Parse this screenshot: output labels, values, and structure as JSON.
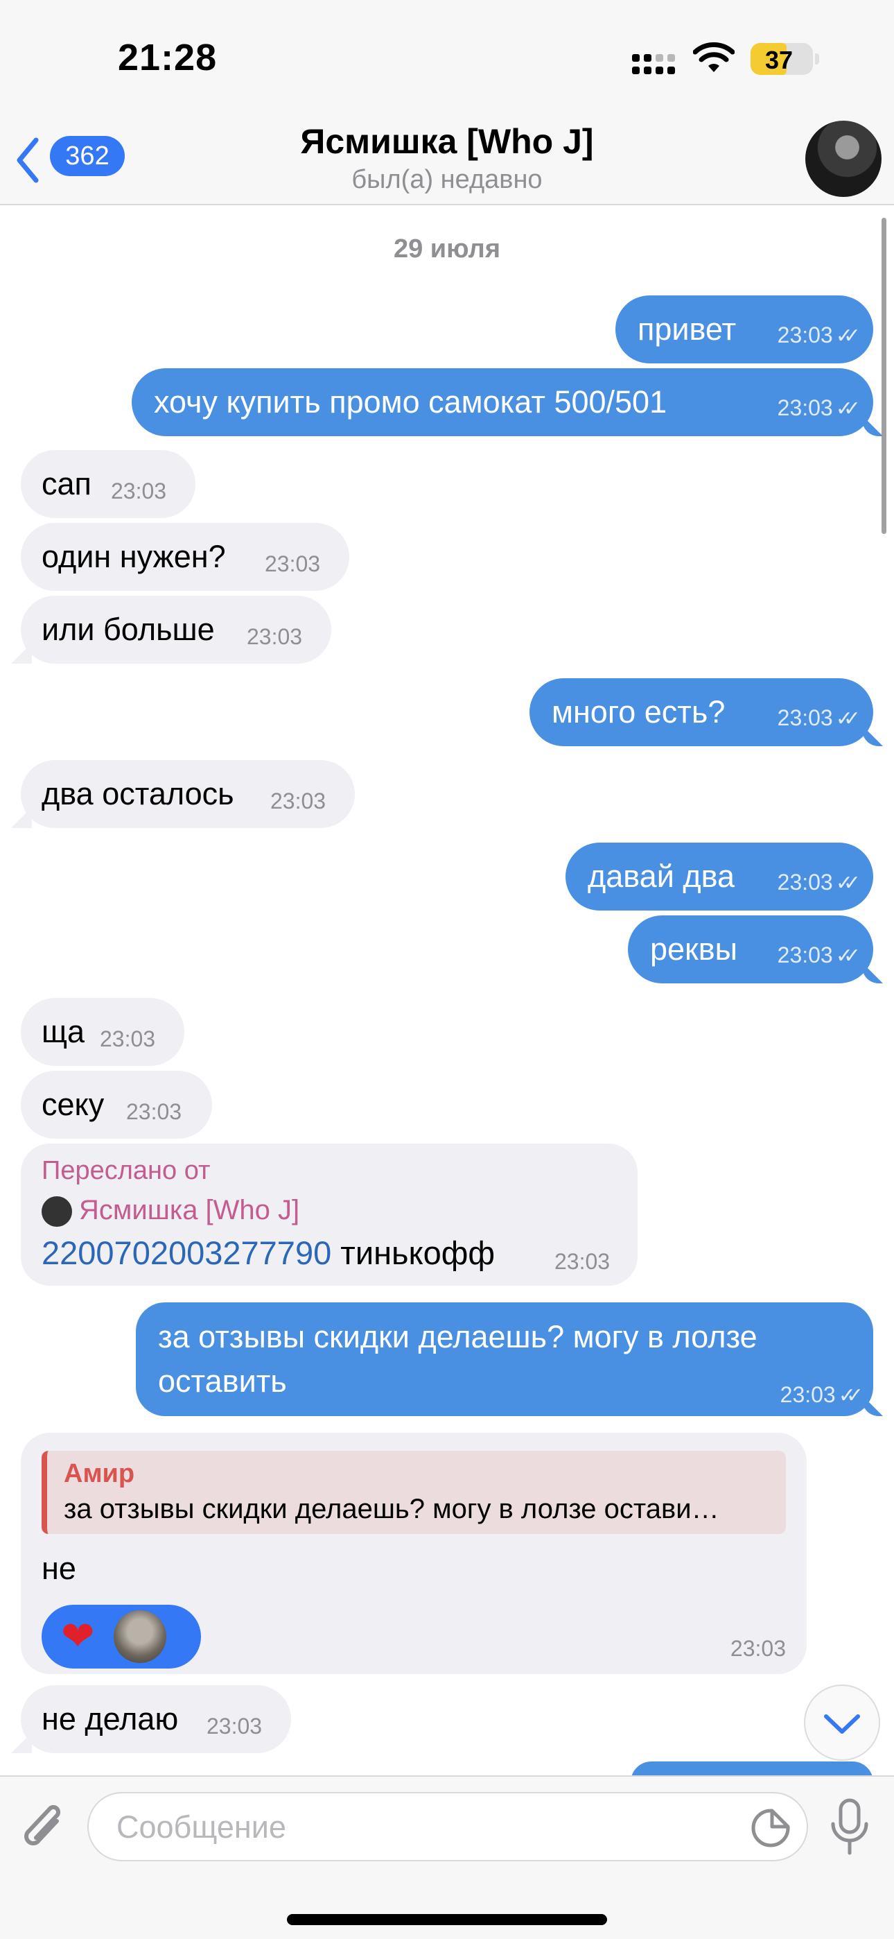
{
  "status": {
    "time": "21:28",
    "battery": "37"
  },
  "header": {
    "back_count": "362",
    "title": "Ясмишка [Who J]",
    "subtitle": "был(а) недавно"
  },
  "chat": {
    "date": "29 июля",
    "messages": [
      {
        "dir": "out",
        "text": "привет",
        "time": "23:03"
      },
      {
        "dir": "out",
        "text": "хочу купить промо самокат 500/501",
        "time": "23:03"
      },
      {
        "dir": "in",
        "text": "сап",
        "time": "23:03"
      },
      {
        "dir": "in",
        "text": "один нужен?",
        "time": "23:03"
      },
      {
        "dir": "in",
        "text": "или больше",
        "time": "23:03"
      },
      {
        "dir": "out",
        "text": "много есть?",
        "time": "23:03"
      },
      {
        "dir": "in",
        "text": "два осталось",
        "time": "23:03"
      },
      {
        "dir": "out",
        "text": "давай два",
        "time": "23:03"
      },
      {
        "dir": "out",
        "text": "реквы",
        "time": "23:03"
      },
      {
        "dir": "in",
        "text": "ща",
        "time": "23:03"
      },
      {
        "dir": "in",
        "text": "секу",
        "time": "23:03"
      }
    ],
    "forwarded": {
      "label": "Переслано от",
      "from": "Ясмишка [Who J]",
      "number": "2200702003277790",
      "bank": " тинькофф",
      "time": "23:03"
    },
    "long_out": {
      "text": "за отзывы скидки делаешь? могу в лолзе оставить",
      "time": "23:03"
    },
    "reply": {
      "quote_name": "Амир",
      "quote_text": "за отзывы скидки делаешь? могу в лолзе остави…",
      "text": "не",
      "reaction": "❤",
      "time": "23:03"
    },
    "last_in": {
      "text": "не делаю",
      "time": "23:03"
    }
  },
  "input": {
    "placeholder": "Сообщение"
  },
  "colors": {
    "outgoing": "#4a90e2",
    "incoming": "#efeff4",
    "accent": "#3478f6"
  }
}
